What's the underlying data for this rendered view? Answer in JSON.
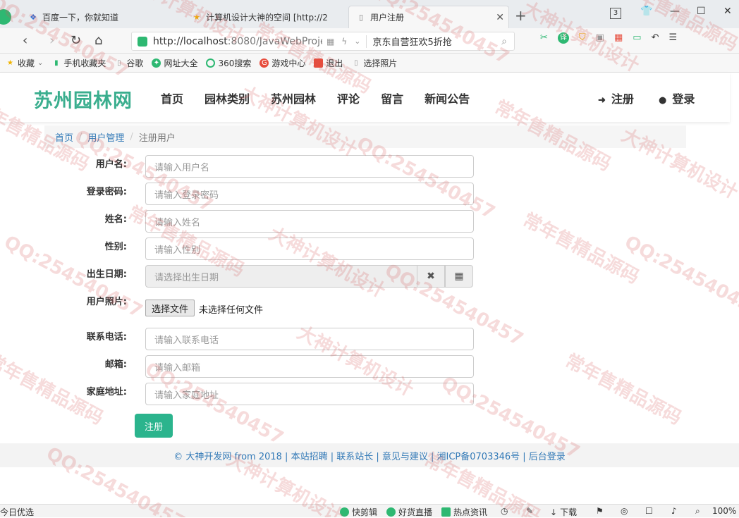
{
  "browser": {
    "tabs": [
      {
        "title": "百度一下，你就知道",
        "icon": "baidu-paw-icon"
      },
      {
        "title": "计算机设计大神的空间 [http://2",
        "icon": "star-icon"
      },
      {
        "title": "用户注册",
        "icon": "page-icon"
      }
    ],
    "tab_counter": "3",
    "url": "http://localhost:8080/JavaWebProje",
    "url_host": "http://localhost",
    "url_rest": ":8080/JavaWebProje",
    "hot_text": "京东自营狂欢5折抢",
    "ext_labels": {
      "translate": "译"
    },
    "bookmarks": [
      "收藏",
      "手机收藏夹",
      "谷歌",
      "网址大全",
      "360搜索",
      "游戏中心",
      "退出",
      "选择照片"
    ]
  },
  "site": {
    "logo": "苏州园林网",
    "menu": [
      "首页",
      "园林类别",
      "苏州园林",
      "评论",
      "留言",
      "新闻公告"
    ],
    "register": "注册",
    "login": "登录",
    "breadcrumb": [
      "首页",
      "用户管理",
      "注册用户"
    ],
    "breadcrumb_sep": "/",
    "form": {
      "username_label": "用户名:",
      "username_ph": "请输入用户名",
      "password_label": "登录密码:",
      "password_ph": "请输入登录密码",
      "name_label": "姓名:",
      "name_ph": "请输入姓名",
      "gender_label": "性别:",
      "gender_ph": "请输入性别",
      "birth_label": "出生日期:",
      "birth_ph": "请选择出生日期",
      "photo_label": "用户照片:",
      "file_btn": "选择文件",
      "file_status": "未选择任何文件",
      "phone_label": "联系电话:",
      "phone_ph": "请输入联系电话",
      "email_label": "邮箱:",
      "email_ph": "请输入邮箱",
      "address_label": "家庭地址:",
      "address_ph": "请输入家庭地址",
      "submit": "注册"
    },
    "footer": "© 大神开发网 from 2018 | 本站招聘 | 联系站长 | 意见与建议 | 湘ICP备0703346号 | 后台登录"
  },
  "statusbar": {
    "left": "今日优选",
    "items": [
      "快剪辑",
      "好货直播",
      "热点资讯",
      "下载"
    ],
    "zoom": "100%"
  },
  "watermark": {
    "texts": [
      "QQ:254540457",
      "大神计算机设计",
      "常年售精品源码"
    ]
  },
  "colors": {
    "accent": "#2bb48d",
    "logo": "#3aae8e",
    "link": "#337ab7"
  }
}
